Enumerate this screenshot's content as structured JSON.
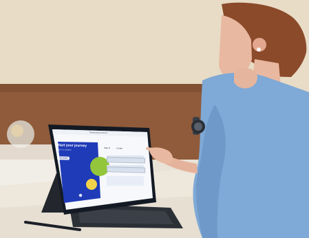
{
  "scene": {
    "colors": {
      "wall": "#e8dcc6",
      "wood_panel": "#8f5b3a",
      "table": "#eee8dc",
      "shirt": "#7fa9d6",
      "skin": "#e9b8a0",
      "hair": "#8b4a2a",
      "tablet_bezel": "#141a24",
      "keyboard": "#2b2f36",
      "hero_blue": "#1f3bb8",
      "hero_green": "#93c63a",
      "hero_yellow": "#f2d34a"
    }
  },
  "tablet_ui": {
    "app_title": "Samsung Account",
    "hero_heading": "Start your journey",
    "hero_subtext": "Sign in to continue",
    "hero_button": "Get started",
    "form_label_1": "Sign in",
    "form_label_2": "Create"
  }
}
